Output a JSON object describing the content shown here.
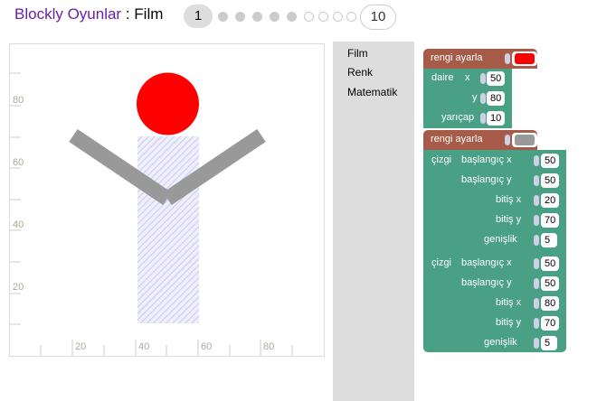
{
  "header": {
    "app_name": "Blockly Oyunlar",
    "separator": " : ",
    "level_name": "Film",
    "current_level": "1",
    "last_level": "10",
    "dots": [
      "done",
      "done",
      "done",
      "done",
      "done",
      "todo",
      "todo",
      "todo",
      "todo"
    ]
  },
  "visualization": {
    "x_ticks": [
      "20",
      "40",
      "60",
      "80"
    ],
    "y_ticks": [
      "80",
      "60",
      "40",
      "20"
    ],
    "colors": {
      "circle": "#ff0000",
      "line": "#999999",
      "target_hatch": "#c9c9f0"
    }
  },
  "toolbox": {
    "categories": [
      "Film",
      "Renk",
      "Matematik"
    ]
  },
  "workspace": {
    "set_color_1": {
      "label": "rengi ayarla",
      "color": "#ff0000"
    },
    "circle": {
      "keyword": "daire",
      "x_label": "x",
      "x_value": "50",
      "y_label": "y",
      "y_value": "80",
      "radius_label": "yarıçap",
      "radius_value": "10"
    },
    "set_color_2": {
      "label": "rengi ayarla",
      "color": "#999999"
    },
    "line_1": {
      "keyword": "çizgi",
      "start_x_label": "başlangıç x",
      "start_x": "50",
      "start_y_label": "başlangıç y",
      "start_y": "50",
      "end_x_label": "bitiş x",
      "end_x": "20",
      "end_y_label": "bitiş y",
      "end_y": "70",
      "width_label": "genişlik",
      "width": "5"
    },
    "line_2": {
      "keyword": "çizgi",
      "start_x_label": "başlangıç x",
      "start_x": "50",
      "start_y_label": "başlangıç y",
      "start_y": "50",
      "end_x_label": "bitiş x",
      "end_x": "80",
      "end_y_label": "bitiş y",
      "end_y": "70",
      "width_label": "genişlik",
      "width": "5"
    }
  }
}
